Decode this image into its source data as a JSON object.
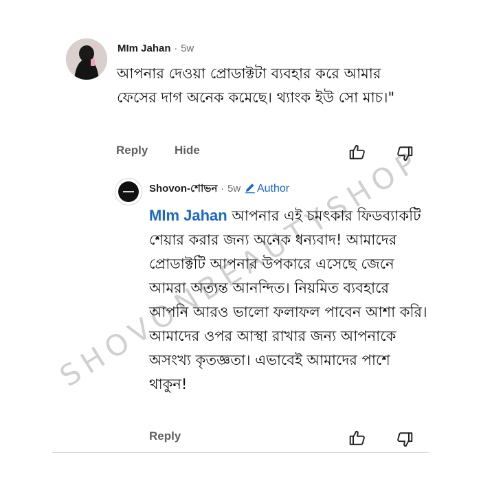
{
  "comment": {
    "author": "MIm Jahan",
    "separator": "·",
    "time": "5w",
    "text": "আপনার দেওয়া প্রোডাক্টটা ব্যবহার করে আমার ফেসের দাগ অনেক কমেছে। থ্যাংক ইউ সো মাচ।\"",
    "actions": {
      "reply_label": "Reply",
      "hide_label": "Hide"
    }
  },
  "reply": {
    "author": "Shovon-শোভন",
    "separator": "·",
    "time": "5w",
    "badge_label": "Author",
    "mention": "MIm Jahan",
    "text": " আপনার এই চমৎকার ফিডব্যাকটি শেয়ার করার জন্য অনেক ধন্যবাদ! আমাদের প্রোডাক্টটি আপনার উপকারে এসেছে জেনে আমরা অত্যন্ত আনন্দিত। নিয়মিত ব্যবহারে আপনি আরও ভালো ফলাফল পাবেন আশা করি। আমাদের ওপর আস্থা রাখার জন্য আপনাকে অসংখ্য কৃতজ্ঞতা। এভাবেই আমাদের পাশে থাকুন!",
    "actions": {
      "reply_label": "Reply"
    }
  },
  "watermark": "SHOVONBEAUTYSHOP",
  "colors": {
    "link_blue": "#1a67c8",
    "action_gray": "#606060",
    "meta_gray": "#6b6b6b"
  },
  "icons": [
    "thumbs-up-icon",
    "thumbs-down-icon",
    "pencil-icon"
  ]
}
